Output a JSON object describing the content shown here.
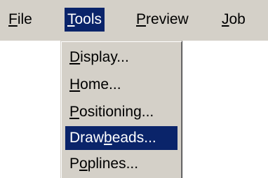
{
  "menubar": {
    "items": [
      {
        "pre": "",
        "key": "F",
        "post": "ile"
      },
      {
        "pre": "",
        "key": "T",
        "post": "ools"
      },
      {
        "pre": "",
        "key": "P",
        "post": "review"
      },
      {
        "pre": "",
        "key": "J",
        "post": "ob"
      }
    ],
    "active_menu": "Tools"
  },
  "tools_menu": {
    "items": [
      {
        "pre": "",
        "key": "D",
        "post": "isplay..."
      },
      {
        "pre": "",
        "key": "H",
        "post": "ome..."
      },
      {
        "pre": "",
        "key": "P",
        "post": "ositioning..."
      },
      {
        "pre": "Draw",
        "key": "b",
        "post": "eads..."
      },
      {
        "pre": "P",
        "key": "o",
        "post": "plines..."
      }
    ],
    "highlighted_item": "Drawbeads..."
  },
  "colors": {
    "menu_background": "#d4d0c8",
    "highlight": "#0a246a",
    "highlight_text": "#ffffff"
  }
}
